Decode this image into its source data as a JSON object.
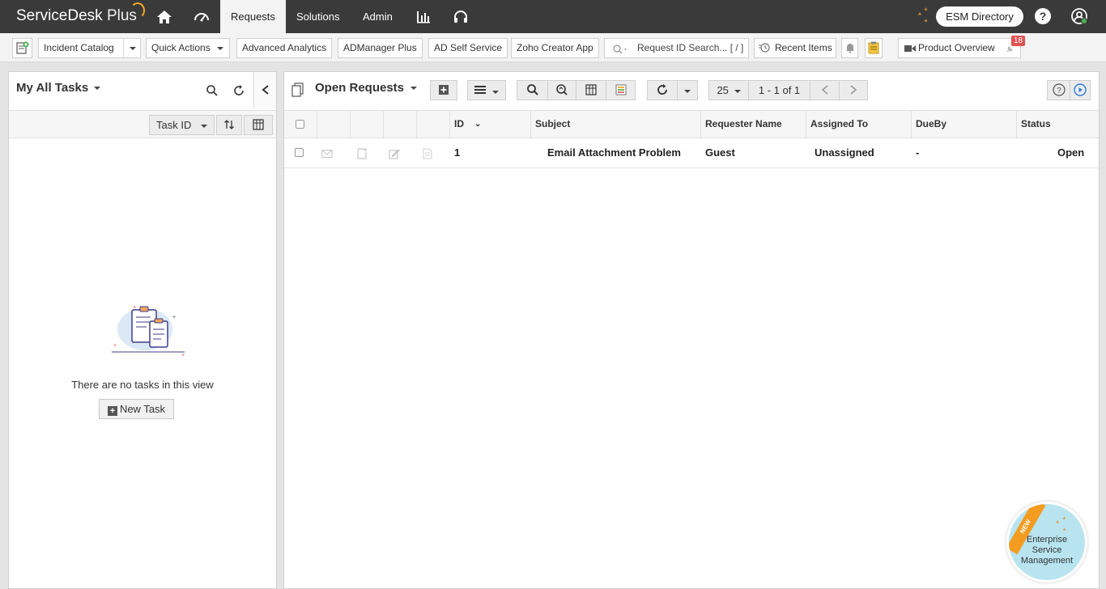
{
  "app": {
    "logo_main": "ServiceDesk",
    "logo_plus": "Plus"
  },
  "nav": {
    "tabs": [
      {
        "label": "Requests",
        "active": true
      },
      {
        "label": "Solutions",
        "active": false
      },
      {
        "label": "Admin",
        "active": false
      }
    ],
    "esm_directory": "ESM Directory",
    "help": "?"
  },
  "toolbar": {
    "incident_catalog": "Incident Catalog",
    "quick_actions": "Quick Actions",
    "advanced_analytics": "Advanced Analytics",
    "admanager_plus": "ADManager Plus",
    "ad_self_service": "AD Self Service",
    "zoho_creator_app": "Zoho Creator App",
    "search_placeholder": "Request ID Search... [ / ]",
    "recent_items": "Recent Items",
    "product_overview": "Product Overview",
    "notification_count": "18"
  },
  "tasks_panel": {
    "title": "My All Tasks",
    "sort_field": "Task ID",
    "empty_message": "There are no tasks in this view",
    "new_task_label": "New Task"
  },
  "requests_panel": {
    "title": "Open Requests",
    "page_size": "25",
    "pagination": "1 - 1 of 1",
    "columns": [
      "ID",
      "Subject",
      "Requester Name",
      "Assigned To",
      "DueBy",
      "Status"
    ],
    "rows": [
      {
        "id": "1",
        "subject": "Email Attachment Problem",
        "requester": "Guest",
        "assigned_to": "Unassigned",
        "due_by": "-",
        "status": "Open"
      }
    ]
  },
  "esm_badge": {
    "ribbon": "NEW",
    "line1": "Enterprise",
    "line2": "Service",
    "line3": "Management"
  },
  "colors": {
    "topbar": "#3a3a3a",
    "accent_orange": "#f39c1f",
    "esm_badge_bg": "#b8e4f0",
    "notification_red": "#e05353"
  }
}
